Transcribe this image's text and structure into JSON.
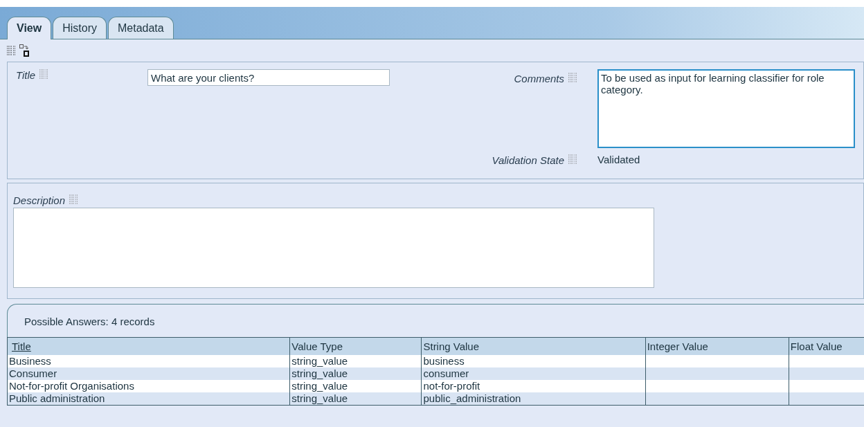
{
  "tabs": [
    {
      "label": "View",
      "selected": true
    },
    {
      "label": "History",
      "selected": false
    },
    {
      "label": "Metadata",
      "selected": false
    }
  ],
  "form": {
    "title": {
      "label": "Title",
      "value": "What are your clients?"
    },
    "comments": {
      "label": "Comments",
      "value": "To be used as input for learning classifier for role category."
    },
    "validation_state": {
      "label": "Validation State",
      "value": "Validated"
    },
    "description": {
      "label": "Description"
    }
  },
  "answers": {
    "caption": "Possible Answers: 4 records",
    "columns": [
      "Title",
      "Value Type",
      "String Value",
      "Integer Value",
      "Float Value"
    ],
    "rows": [
      [
        "Business",
        "string_value",
        "business",
        "",
        ""
      ],
      [
        "Consumer",
        "string_value",
        "consumer",
        "",
        ""
      ],
      [
        "Not-for-profit Organisations",
        "string_value",
        "not-for-profit",
        "",
        ""
      ],
      [
        "Public administration",
        "string_value",
        "public_administration",
        "",
        ""
      ]
    ]
  }
}
